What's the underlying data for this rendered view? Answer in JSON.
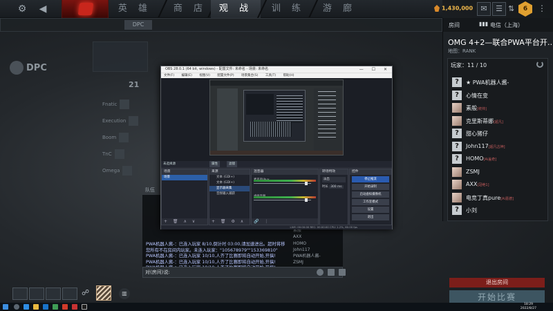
{
  "nav": {
    "tabs": [
      "英 雄",
      "商 店",
      "观 战",
      "训 练",
      "游 廊"
    ],
    "active_tab": "观 战",
    "currency": "1,430,000",
    "level": "6"
  },
  "dpc": {
    "title": "DPC",
    "region_title": "DPC",
    "score": "21",
    "teams": [
      "Fnatic",
      "Execution",
      "Boom",
      "TnC",
      "Omega"
    ]
  },
  "room": {
    "header_label": "房间",
    "server": "电信（上海）",
    "name": "OMG 4+2—联合PWA平台开…",
    "map": "地图：RANK",
    "players_label": "玩家：11 / 10",
    "players": [
      {
        "name": "★ PWA机器人酱-",
        "avatar": "?",
        "rank": ""
      },
      {
        "name": "心情在变",
        "avatar": "?",
        "rank": ""
      },
      {
        "name": "素般",
        "avatar": "img",
        "rank": "[统帅]"
      },
      {
        "name": "克里斯蒂娜",
        "avatar": "img",
        "rank": "[超凡]"
      },
      {
        "name": "甜心猪仔",
        "avatar": "?",
        "rank": ""
      },
      {
        "name": "John117",
        "avatar": "?",
        "rank": "[超凡古神]"
      },
      {
        "name": "HOMO",
        "avatar": "?",
        "rank": "[Ai盖奇]"
      },
      {
        "name": "ZSMJ",
        "avatar": "img",
        "rank": ""
      },
      {
        "name": "AXX",
        "avatar": "img",
        "rank": "[冠绝1]"
      },
      {
        "name": "电竞丁真pure",
        "avatar": "img",
        "rank": "[Ai嘉德]"
      },
      {
        "name": "小刘",
        "avatar": "?",
        "rank": ""
      }
    ],
    "leave_button": "退出房间",
    "start_button": "开始比赛"
  },
  "chat": {
    "tab": "队伍",
    "input_placeholder": "对(房间)说:",
    "lines": [
      "PWA机器人酱-：已连入玩家 8/10,倒计时 03:00,请加速进出。超时将移",
      "您所有不在房间内玩家。未连入玩家：\"105678979\"\"153369810\"",
      "PWA机器人酱-：已连入玩家 10/10,人齐了比赛即将自动开始,开搞!",
      "PWA机器人酱-：已连入玩家 10/10,人齐了比赛即将自动开始,开搞!",
      "PWA机器人酱-：已连入玩家 10/10,人齐了比赛即将自动开始,开搞!",
      "PWA机器人酱-：已连入玩家 10/10,人齐了比赛即将自动开始,开搞!"
    ],
    "side_names": [
      "素般",
      "AXX",
      "HOMO",
      "John117",
      "PWA机器人酱-",
      "ZSMJ"
    ]
  },
  "obs": {
    "title": "OBS 28.0.1 (64 bit, windows) - 配置文件: 未命名 - 场景: 未命名",
    "menu": [
      "文件(F)",
      "编辑(E)",
      "视图(V)",
      "配置文件(P)",
      "场景集合(S)",
      "工具(T)",
      "帮助(H)"
    ],
    "controls_row": "未选择源",
    "controls_btns": [
      "属性",
      "滤镜"
    ],
    "docks": {
      "scenes": {
        "title": "场景",
        "items": [
          "场景"
        ]
      },
      "sources": {
        "title": "来源",
        "items": [
          "文本 (GDI+)",
          "文本 (GDI+)",
          "显示器采集",
          "音频输入捕获"
        ]
      },
      "mixer": {
        "title": "混音器",
        "channels": [
          "麦克风/Aux",
          "桌面音频"
        ]
      },
      "transitions": {
        "title": "转场特效",
        "effect": "淡出",
        "duration_label": "时长",
        "duration": "300 ms"
      },
      "controls": {
        "title": "控件",
        "buttons": [
          "停止推流",
          "开始录制",
          "启动虚拟摄像机",
          "工作室模式",
          "设置",
          "退出"
        ]
      }
    },
    "status": "LIVE: 00:00:00    REC: 00:00:00    CPU: 1.2%, 60.00 fps"
  },
  "taskbar": {
    "time": "18:29",
    "date": "2022/8/27"
  },
  "colors": {
    "accent_red": "#c8261c",
    "stream_blue": "#2a5bb0",
    "gold": "#f0b84a"
  }
}
